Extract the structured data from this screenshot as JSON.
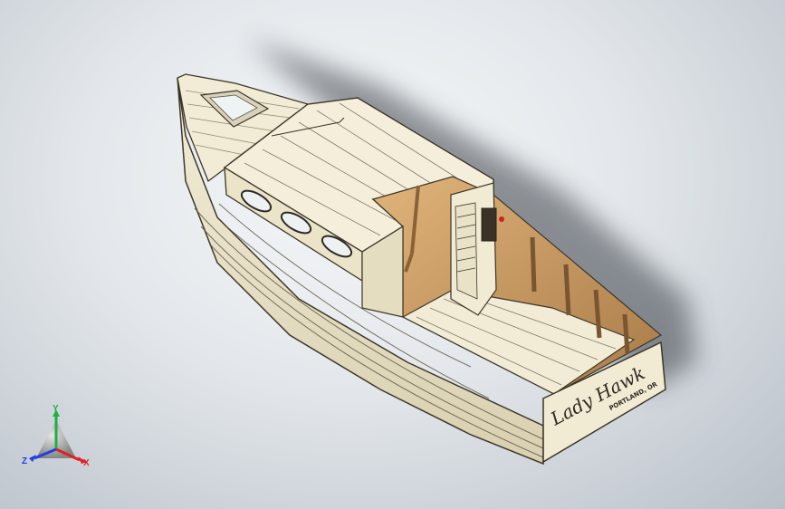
{
  "model": {
    "transom": {
      "name_line": "Lady Hawk",
      "port_line": "PORTLAND, OR"
    }
  },
  "triad": {
    "y_label": "Y",
    "x_label": "X",
    "z_label": "Z",
    "colors": {
      "x": "#e02020",
      "y": "#20b040",
      "z": "#2040e0"
    }
  },
  "colors": {
    "hull": "#efe9d2",
    "hull_shadow": "#dcd4b6",
    "plank_line": "#5a5140",
    "deck_wood": "#c79a62",
    "background_center": "#f6f8fa",
    "background_edge": "#b9c0c8"
  }
}
